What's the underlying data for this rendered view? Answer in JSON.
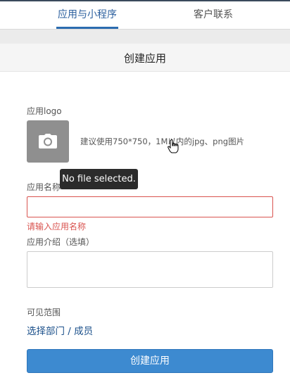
{
  "tabs": [
    {
      "label": "应用与小程序",
      "active": true
    },
    {
      "label": "客户联系",
      "active": false
    }
  ],
  "page": {
    "title": "创建应用"
  },
  "logo": {
    "label": "应用logo",
    "hint": "建议使用750*750，1M以内的jpg、png图片",
    "tooltip": "No file selected."
  },
  "name_field": {
    "label": "应用名称",
    "value": "",
    "error": "请输入应用名称"
  },
  "intro_field": {
    "label": "应用介绍（选填）",
    "value": ""
  },
  "visibility": {
    "label": "可见范围",
    "link": "选择部门 / 成员"
  },
  "submit": {
    "label": "创建应用"
  },
  "colors": {
    "accent": "#3d8ad0",
    "error": "#d9534f",
    "link": "#1a4f8a"
  },
  "icons": [
    "camera-icon",
    "hand-pointer-icon"
  ]
}
